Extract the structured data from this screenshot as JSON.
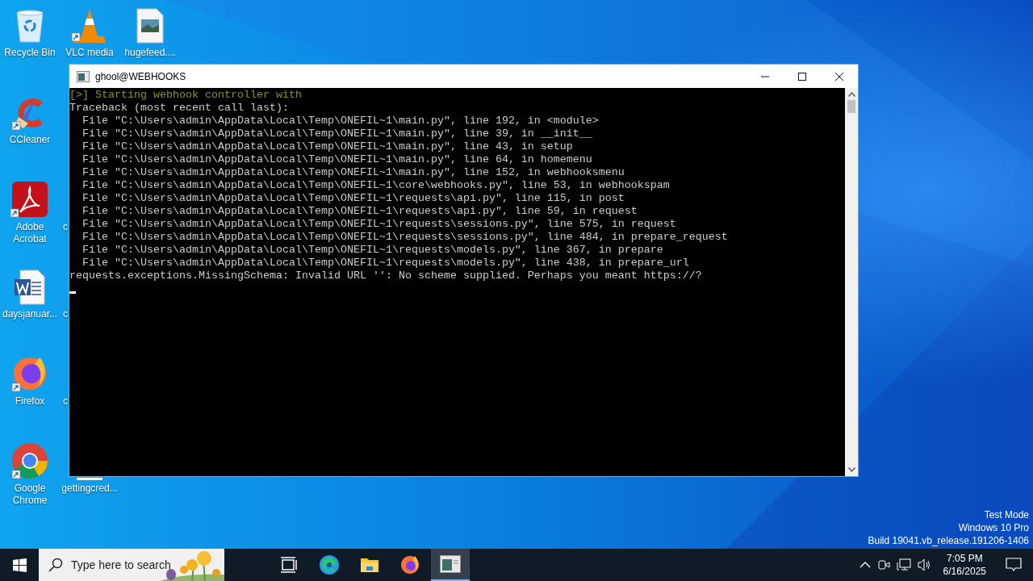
{
  "desktop_icons": [
    {
      "label": "Recycle Bin",
      "kind": "recycle"
    },
    {
      "label": "VLC media",
      "kind": "vlc"
    },
    {
      "label": "hugefeed....",
      "kind": "image-file"
    },
    {
      "label": "CCleaner",
      "kind": "ccleaner"
    },
    {
      "label": "Adobe Acrobat",
      "kind": "pdf"
    },
    {
      "label": "c",
      "kind": "covered"
    },
    {
      "label": "daysjanuar...",
      "kind": "word"
    },
    {
      "label": "c",
      "kind": "covered"
    },
    {
      "label": "Firefox",
      "kind": "firefox"
    },
    {
      "label": "c",
      "kind": "covered"
    },
    {
      "label": "Google Chrome",
      "kind": "chrome"
    },
    {
      "label": "gettingcred...",
      "kind": "covered-bar"
    }
  ],
  "console_window": {
    "title": "ghool@WEBHOOKS",
    "lines": [
      {
        "kind": "status",
        "text": "[>] Starting webhook controller with"
      },
      {
        "kind": "plain",
        "text": "Traceback (most recent call last):"
      },
      {
        "kind": "plain",
        "text": "  File \"C:\\Users\\admin\\AppData\\Local\\Temp\\ONEFIL~1\\main.py\", line 192, in <module>"
      },
      {
        "kind": "plain",
        "text": "  File \"C:\\Users\\admin\\AppData\\Local\\Temp\\ONEFIL~1\\main.py\", line 39, in __init__"
      },
      {
        "kind": "plain",
        "text": "  File \"C:\\Users\\admin\\AppData\\Local\\Temp\\ONEFIL~1\\main.py\", line 43, in setup"
      },
      {
        "kind": "plain",
        "text": "  File \"C:\\Users\\admin\\AppData\\Local\\Temp\\ONEFIL~1\\main.py\", line 64, in homemenu"
      },
      {
        "kind": "plain",
        "text": "  File \"C:\\Users\\admin\\AppData\\Local\\Temp\\ONEFIL~1\\main.py\", line 152, in webhooksmenu"
      },
      {
        "kind": "plain",
        "text": "  File \"C:\\Users\\admin\\AppData\\Local\\Temp\\ONEFIL~1\\core\\webhooks.py\", line 53, in webhookspam"
      },
      {
        "kind": "plain",
        "text": "  File \"C:\\Users\\admin\\AppData\\Local\\Temp\\ONEFIL~1\\requests\\api.py\", line 115, in post"
      },
      {
        "kind": "plain",
        "text": "  File \"C:\\Users\\admin\\AppData\\Local\\Temp\\ONEFIL~1\\requests\\api.py\", line 59, in request"
      },
      {
        "kind": "plain",
        "text": "  File \"C:\\Users\\admin\\AppData\\Local\\Temp\\ONEFIL~1\\requests\\sessions.py\", line 575, in request"
      },
      {
        "kind": "plain",
        "text": "  File \"C:\\Users\\admin\\AppData\\Local\\Temp\\ONEFIL~1\\requests\\sessions.py\", line 484, in prepare_request"
      },
      {
        "kind": "plain",
        "text": "  File \"C:\\Users\\admin\\AppData\\Local\\Temp\\ONEFIL~1\\requests\\models.py\", line 367, in prepare"
      },
      {
        "kind": "plain",
        "text": "  File \"C:\\Users\\admin\\AppData\\Local\\Temp\\ONEFIL~1\\requests\\models.py\", line 438, in prepare_url"
      },
      {
        "kind": "plain",
        "text": "requests.exceptions.MissingSchema: Invalid URL '': No scheme supplied. Perhaps you meant https://?"
      }
    ]
  },
  "system_notice": [
    "Test Mode",
    "Windows 10 Pro",
    "Build 19041.vb_release.191206-1406"
  ],
  "taskbar": {
    "search": {
      "placeholder": "Type here to search"
    },
    "apps": [
      {
        "kind": "task-view",
        "selected": false
      },
      {
        "kind": "edge",
        "selected": false
      },
      {
        "kind": "explorer",
        "selected": false
      },
      {
        "kind": "firefox",
        "selected": false
      },
      {
        "kind": "console",
        "selected": true
      }
    ],
    "clock": {
      "time": "7:05 PM",
      "date": "6/16/2025"
    }
  }
}
